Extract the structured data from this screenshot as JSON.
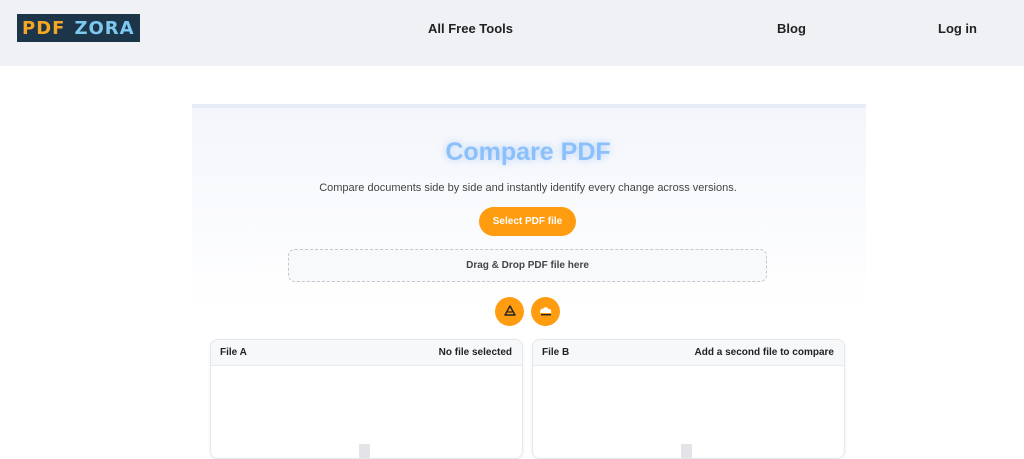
{
  "header": {
    "logo": {
      "left": "PDF",
      "right": "ZORA"
    },
    "nav": {
      "tools": "All Free Tools",
      "blog": "Blog",
      "login": "Log in"
    }
  },
  "main": {
    "title": "Compare PDF",
    "subtitle": "Compare documents side by side and instantly identify every change across versions.",
    "select_button": "Select PDF file",
    "dropzone": "Drag & Drop PDF file here",
    "icons": [
      "google-drive-icon",
      "cloud-upload-icon"
    ]
  },
  "files": {
    "a": {
      "label": "File A",
      "status": "No file selected"
    },
    "b": {
      "label": "File B",
      "status": "Add a second file to compare"
    }
  },
  "colors": {
    "accent": "#ff9c10",
    "title": "#8cc0fb",
    "header_bg": "#eff1f5",
    "logo_bg": "#1c3548"
  }
}
